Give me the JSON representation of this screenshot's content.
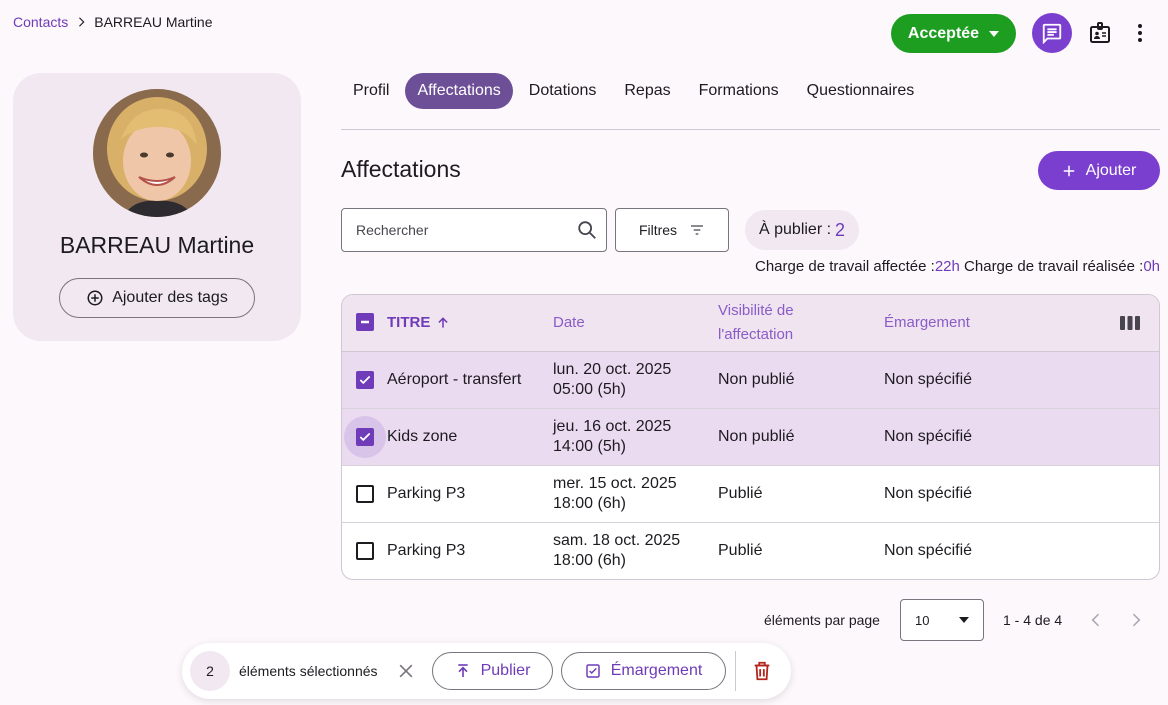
{
  "breadcrumb": {
    "parent": "Contacts",
    "current": "BARREAU Martine"
  },
  "header": {
    "status_label": "Acceptée"
  },
  "profile": {
    "name": "BARREAU Martine",
    "tags_button": "Ajouter des tags"
  },
  "tabs": [
    {
      "label": "Profil"
    },
    {
      "label": "Affectations"
    },
    {
      "label": "Dotations"
    },
    {
      "label": "Repas"
    },
    {
      "label": "Formations"
    },
    {
      "label": "Questionnaires"
    }
  ],
  "active_tab": "Affectations",
  "section": {
    "title": "Affectations",
    "add_label": "Ajouter"
  },
  "search": {
    "placeholder": "Rechercher"
  },
  "filters_label": "Filtres",
  "to_publish": {
    "label": "À publier :",
    "count": "2"
  },
  "workload": {
    "assigned_label": "Charge de travail affectée :",
    "assigned_value": "22h",
    "done_label": "Charge de travail réalisée :",
    "done_value": "0h"
  },
  "table": {
    "headers": {
      "title": "TITRE",
      "date": "Date",
      "visibility_line1": "Visibilité de",
      "visibility_line2": "l'affectation",
      "signin": "Émargement"
    },
    "rows": [
      {
        "title": "Aéroport - transfert",
        "date_line1": "lun. 20 oct. 2025",
        "date_line2": "05:00 (5h)",
        "visibility": "Non publié",
        "signin": "Non spécifié",
        "selected": true
      },
      {
        "title": "Kids zone",
        "date_line1": "jeu. 16 oct. 2025",
        "date_line2": "14:00 (5h)",
        "visibility": "Non publié",
        "signin": "Non spécifié",
        "selected": true
      },
      {
        "title": "Parking P3",
        "date_line1": "mer. 15 oct. 2025",
        "date_line2": "18:00 (6h)",
        "visibility": "Publié",
        "signin": "Non spécifié",
        "selected": false
      },
      {
        "title": "Parking P3",
        "date_line1": "sam. 18 oct. 2025",
        "date_line2": "18:00 (6h)",
        "visibility": "Publié",
        "signin": "Non spécifié",
        "selected": false
      }
    ]
  },
  "pagination": {
    "per_page_label": "éléments par page",
    "per_page_value": "10",
    "range": "1 - 4 de 4"
  },
  "bulk": {
    "count": "2",
    "label": "éléments sélectionnés",
    "publish_label": "Publier",
    "signin_label": "Émargement"
  },
  "colors": {
    "primary": "#7b3fd0",
    "accent_text": "#6f3bb8",
    "success": "#1e9e21",
    "danger": "#b3261e",
    "selected_row": "#ebdbf1"
  }
}
